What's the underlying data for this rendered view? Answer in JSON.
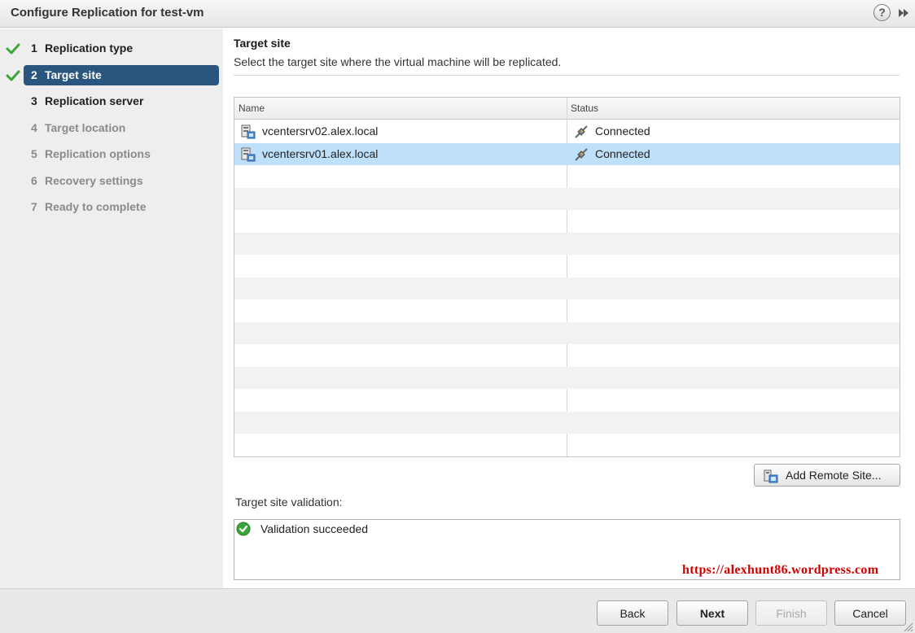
{
  "window": {
    "title": "Configure Replication for test-vm",
    "help_glyph": "?"
  },
  "steps": [
    {
      "num": "1",
      "label": "Replication type",
      "state": "done"
    },
    {
      "num": "2",
      "label": "Target site",
      "state": "current"
    },
    {
      "num": "3",
      "label": "Replication server",
      "state": "next"
    },
    {
      "num": "4",
      "label": "Target location",
      "state": "future"
    },
    {
      "num": "5",
      "label": "Replication options",
      "state": "future"
    },
    {
      "num": "6",
      "label": "Recovery settings",
      "state": "future"
    },
    {
      "num": "7",
      "label": "Ready to complete",
      "state": "future"
    }
  ],
  "main": {
    "title": "Target site",
    "description": "Select the target site where the virtual machine will be replicated.",
    "grid": {
      "columns": [
        "Name",
        "Status"
      ],
      "rows": [
        {
          "name": "vcentersrv02.alex.local",
          "status": "Connected",
          "selected": false
        },
        {
          "name": "vcentersrv01.alex.local",
          "status": "Connected",
          "selected": true
        }
      ]
    },
    "add_remote_site_label": "Add Remote Site...",
    "validation_label": "Target site validation:",
    "validation_message": "Validation succeeded",
    "watermark": "https://alexhunt86.wordpress.com"
  },
  "footer": {
    "back": "Back",
    "next": "Next",
    "finish": "Finish",
    "cancel": "Cancel"
  },
  "colors": {
    "current_step": "#2a557f",
    "selected_row": "#bfe0fb",
    "check_green": "#3aa53a",
    "watermark_red": "#d40000"
  }
}
